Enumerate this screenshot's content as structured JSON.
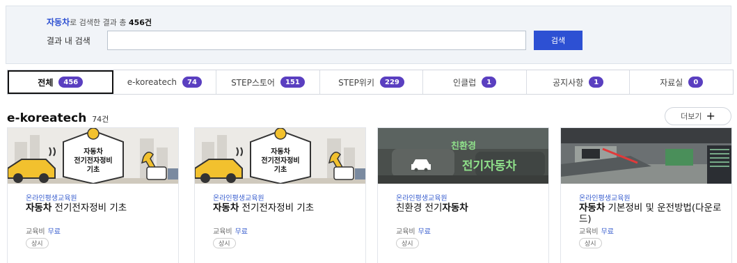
{
  "summary": {
    "keyword": "자동차",
    "text_mid": "로 검색한 결과 총 ",
    "count": "456건"
  },
  "search": {
    "label": "결과 내 검색",
    "value": "",
    "placeholder": "",
    "button_label": "검색"
  },
  "tabs": [
    {
      "label": "전체",
      "count": "456"
    },
    {
      "label": "e-koreatech",
      "count": "74"
    },
    {
      "label": "STEP스토어",
      "count": "151"
    },
    {
      "label": "STEP위키",
      "count": "229"
    },
    {
      "label": "인클럽",
      "count": "1"
    },
    {
      "label": "공지사항",
      "count": "1"
    },
    {
      "label": "자료실",
      "count": "0"
    }
  ],
  "section": {
    "title": "e-koreatech",
    "count": "74건",
    "more_label": "더보기"
  },
  "cards": [
    {
      "org": "온라인평생교육원",
      "title_bold": "자동차",
      "title_rest": " 전기전자정비 기초",
      "fee_label": "교육비",
      "fee_value": "무료",
      "tag": "상시",
      "thumb_text": [
        "자동차",
        "전기전자정비",
        "기초"
      ]
    },
    {
      "org": "온라인평생교육원",
      "title_bold": "자동차",
      "title_rest": " 전기전자정비 기초",
      "fee_label": "교육비",
      "fee_value": "무료",
      "tag": "상시",
      "thumb_text": [
        "자동차",
        "전기전자정비",
        "기초"
      ]
    },
    {
      "org": "온라인평생교육원",
      "title_pre": "친환경 전기",
      "title_bold": "자동차",
      "fee_label": "교육비",
      "fee_value": "무료",
      "tag": "상시",
      "thumb_text": [
        "친환경",
        "전기자동차"
      ]
    },
    {
      "org": "온라인평생교육원",
      "title_bold": "자동차",
      "title_rest": " 기본정비 및 운전방법(다운로드)",
      "fee_label": "교육비",
      "fee_value": "무료",
      "tag": "상시"
    }
  ],
  "colors": {
    "accent": "#2d50d3",
    "badge": "#5a3fc0",
    "org_text": "#3a5fcf",
    "panel_bg": "#f1f4f8"
  }
}
